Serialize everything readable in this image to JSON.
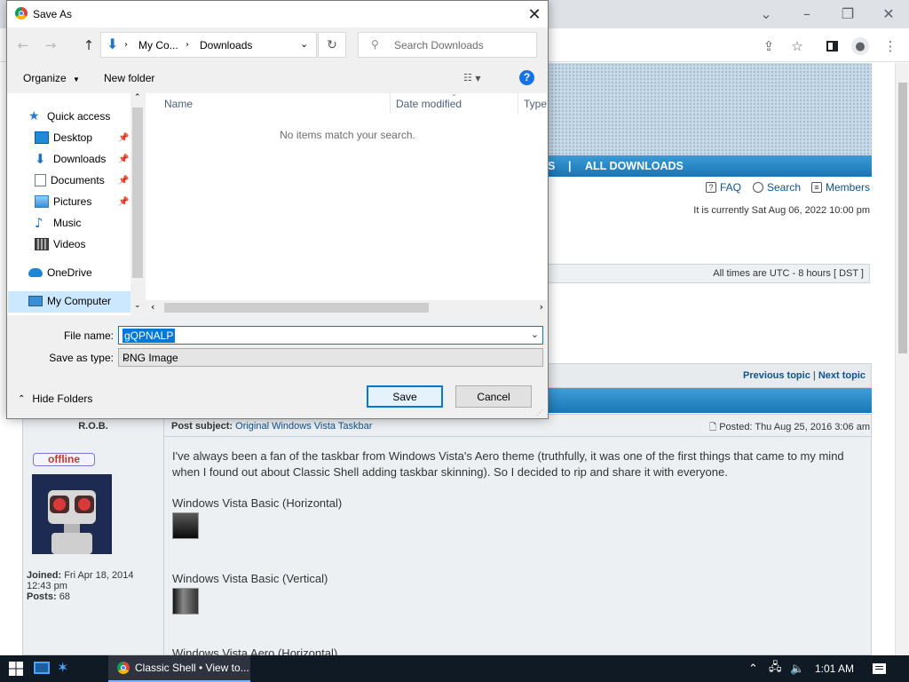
{
  "browser": {
    "toolbar_icons": [
      "share-icon",
      "star-icon",
      "side-panel-icon",
      "profile-icon",
      "menu-icon"
    ]
  },
  "forum": {
    "nav_fragment": "S",
    "nav_separator": "|",
    "nav_all_downloads": "ALL DOWNLOADS",
    "links": {
      "faq": "FAQ",
      "search": "Search",
      "members": "Members"
    },
    "date_line": "It is currently Sat Aug 06, 2022 10:00 pm",
    "times_note": "All times are UTC - 8 hours [ DST ]",
    "prev_topic": "Previous topic",
    "topic_sep": "|",
    "next_topic": "Next topic",
    "author": "R.O.B.",
    "subject_label": "Post subject:",
    "subject_value": "Original Windows Vista Taskbar",
    "posted": "Posted: Thu Aug 25, 2016 3:06 am",
    "status_badge": "offline",
    "joined_label": "Joined:",
    "joined_value": "Fri Apr 18, 2014 12:43 pm",
    "posts_label": "Posts:",
    "posts_value": "68",
    "post_text": "I've always been a fan of the taskbar from Windows Vista's Aero theme (truthfully, it was one of the first things that came to my mind when I found out about Classic Shell adding taskbar skinning). So I decided to rip and share it with everyone.",
    "sections": [
      "Windows Vista Basic (Horizontal)",
      "Windows Vista Basic (Vertical)",
      "Windows Vista Aero (Horizontal)"
    ]
  },
  "dialog": {
    "title": "Save As",
    "breadcrumb": [
      "My Co...",
      "Downloads"
    ],
    "search_placeholder": "Search Downloads",
    "organize": "Organize",
    "new_folder": "New folder",
    "help": "?",
    "nav_items": [
      {
        "label": "Quick access",
        "icon": "star-icon",
        "color": "#2a79d3"
      },
      {
        "label": "Desktop",
        "icon": "desktop-icon",
        "color": "#1f8ad8",
        "pinned": true
      },
      {
        "label": "Downloads",
        "icon": "download-arrow-icon",
        "color": "#1f73c9",
        "pinned": true
      },
      {
        "label": "Documents",
        "icon": "document-icon",
        "color": "#6d7a8a",
        "pinned": true
      },
      {
        "label": "Pictures",
        "icon": "picture-icon",
        "color": "#4aa3df",
        "pinned": true
      },
      {
        "label": "Music",
        "icon": "music-note-icon",
        "color": "#1f73c9"
      },
      {
        "label": "Videos",
        "icon": "film-icon",
        "color": "#555555"
      },
      {
        "label": "OneDrive",
        "icon": "cloud-icon",
        "color": "#1f86d6"
      },
      {
        "label": "My Computer",
        "icon": "computer-icon",
        "color": "#3a8fd6"
      }
    ],
    "columns": [
      "Name",
      "Date modified",
      "Type"
    ],
    "empty_message": "No items match your search.",
    "file_name_label": "File name:",
    "file_name_value": "gQPNALP",
    "save_type_label": "Save as type:",
    "save_type_value": "PNG Image",
    "hide_folders": "Hide Folders",
    "save": "Save",
    "cancel": "Cancel"
  },
  "taskbar": {
    "app_label": "Classic Shell • View to...",
    "time": "1:01 AM"
  }
}
